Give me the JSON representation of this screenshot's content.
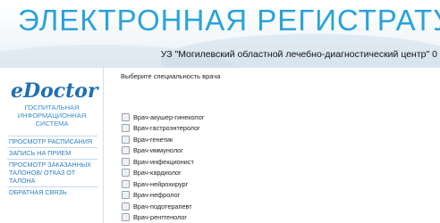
{
  "header": {
    "title": "ЭЛЕКТРОННАЯ РЕГИСТРАТУРА",
    "organization": "УЗ \"Могилевский областной лечебно-диагностический центр\" 0"
  },
  "sidebar": {
    "logo_text": "eDoctor",
    "logo_subtitle": "ГОСПИТАЛЬНАЯ ИНФОРМАЦИОННАЯ СИСТЕМА",
    "nav": [
      {
        "label": "ПРОСМОТР РАСПИСАНИЯ"
      },
      {
        "label": "ЗАПИСЬ НА ПРИЕМ"
      },
      {
        "label": "ПРОСМОТР ЗАКАЗАННЫХ ТАЛОНОВ/ ОТКАЗ ОТ ТАЛОНА"
      },
      {
        "label": "ОБРАТНАЯ СВЯЗЬ"
      }
    ]
  },
  "main": {
    "prompt": "Выберите специальность врача",
    "specialties": [
      {
        "label": "Врач-акушер-гинеколог",
        "checked": false
      },
      {
        "label": "Врач-гастроэнтеролог",
        "checked": false
      },
      {
        "label": "Врач-генетик",
        "checked": false
      },
      {
        "label": "Врач-иммунолог",
        "checked": false
      },
      {
        "label": "Врач-инфекционист",
        "checked": false
      },
      {
        "label": "Врач-кардиолог",
        "checked": false
      },
      {
        "label": "Врач-нейрохирург",
        "checked": false
      },
      {
        "label": "Врач-нефролог",
        "checked": false
      },
      {
        "label": "Врач-подотерапевт",
        "checked": false
      },
      {
        "label": "Врач-рентгенолог",
        "checked": false
      }
    ]
  },
  "colors": {
    "title": "#29a3da",
    "logo": "#1f6fb4",
    "nav_link": "#2a7fc0"
  }
}
